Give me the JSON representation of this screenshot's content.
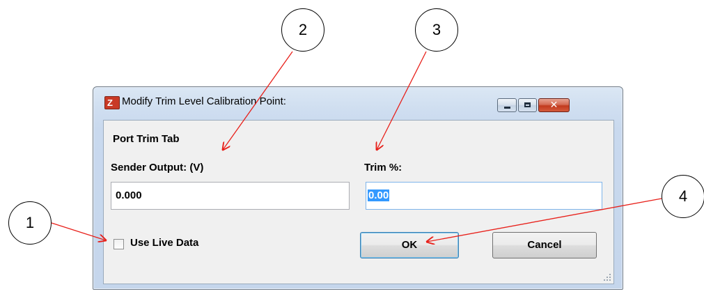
{
  "callouts": [
    "1",
    "2",
    "3",
    "4"
  ],
  "window": {
    "title": "Modify Trim Level Calibration Point:",
    "app_icon": "cz-app-icon",
    "controls": [
      "minimize-icon",
      "maximize-icon",
      "close-icon"
    ]
  },
  "form": {
    "section_label": "Port Trim Tab",
    "sender_label": "Sender Output: (V)",
    "sender_value": "0.000",
    "trim_label": "Trim %:",
    "trim_value": "0.00",
    "use_live_data_label": "Use Live Data",
    "use_live_data_checked": false,
    "ok_label": "OK",
    "cancel_label": "Cancel"
  },
  "colors": {
    "callout_arrow": "#e8201a",
    "close_button": "#c23a1e",
    "selection": "#3399ff"
  }
}
